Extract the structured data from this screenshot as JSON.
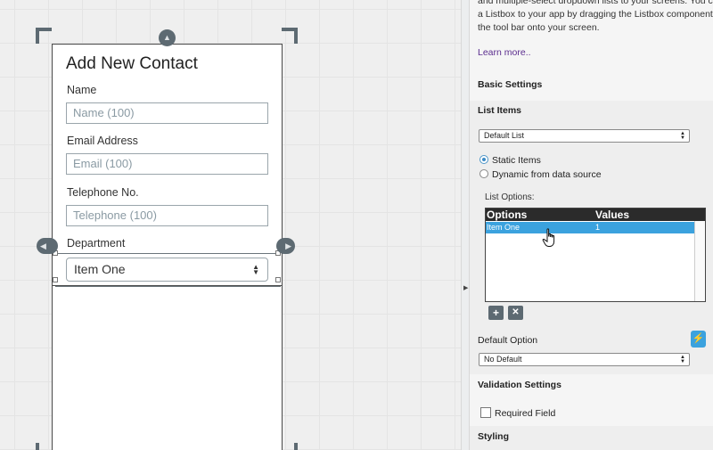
{
  "canvas": {
    "form_title": "Add New Contact",
    "fields": [
      {
        "label": "Name",
        "placeholder": "Name (100)"
      },
      {
        "label": "Email Address",
        "placeholder": "Email (100)"
      },
      {
        "label": "Telephone No.",
        "placeholder": "Telephone (100)"
      }
    ],
    "department_label": "Department",
    "department_value": "Item One"
  },
  "panel": {
    "intro_lines": [
      "and multiple-select dropdown lists to your screens. You ca",
      "a Listbox to your app by dragging the Listbox component fr",
      "the tool bar onto your screen."
    ],
    "learn_more": "Learn more..",
    "basic_settings": "Basic Settings",
    "list_items": "List Items",
    "list_select_value": "Default List",
    "radio_static": "Static Items",
    "radio_dynamic": "Dynamic from data source",
    "list_options_label": "List Options:",
    "table": {
      "headers": [
        "Options",
        "Values"
      ],
      "rows": [
        [
          "Item One",
          "1"
        ]
      ]
    },
    "add_symbol": "+",
    "remove_symbol": "✕",
    "default_option_label": "Default Option",
    "default_option_value": "No Default",
    "flash_icon": "⚡",
    "validation_settings": "Validation Settings",
    "required_field": "Required Field",
    "styling": "Styling"
  },
  "colors": {
    "accent": "#3ba2de",
    "link": "#5b2d8e",
    "handle_gray": "#5d6a72"
  },
  "icons": [
    "chevron-up-icon",
    "chevron-left-icon",
    "chevron-right-icon",
    "select-arrows-icon",
    "hand-pointer-icon",
    "plus-icon",
    "close-icon",
    "lightning-icon"
  ]
}
